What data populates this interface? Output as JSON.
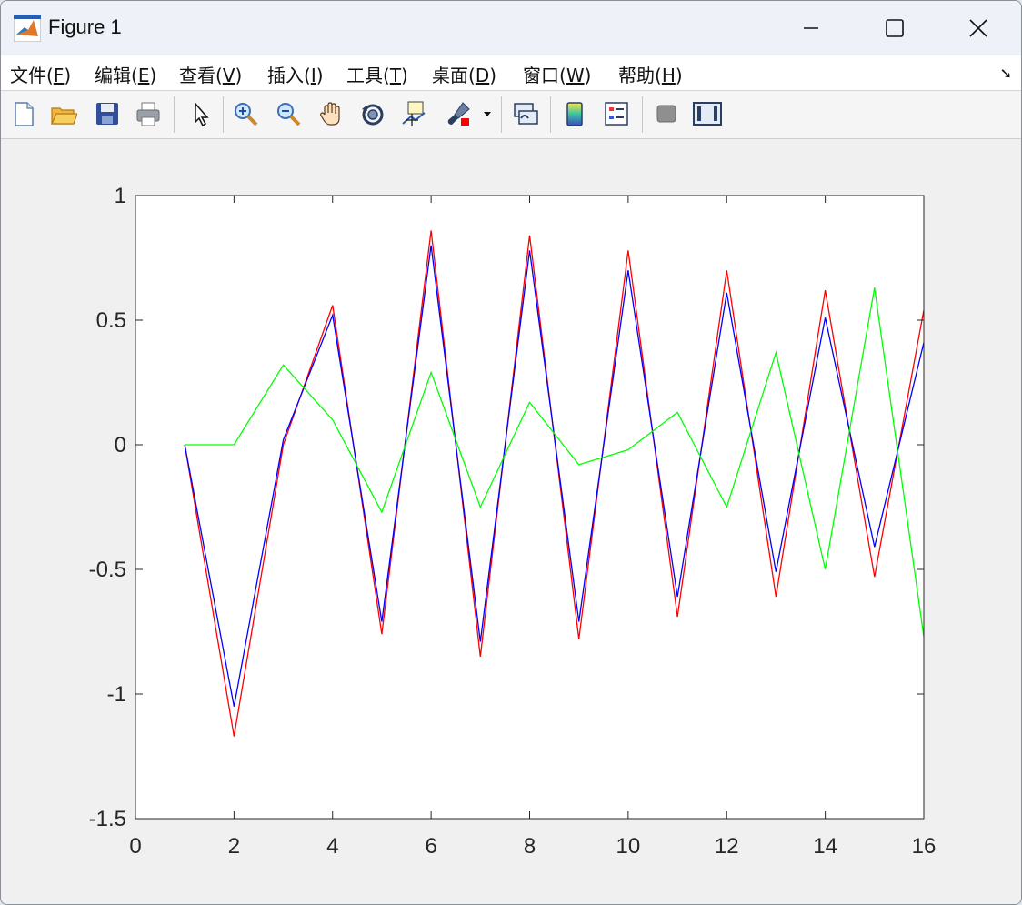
{
  "window": {
    "title": "Figure 1"
  },
  "menu": {
    "items": [
      {
        "label": "文件(",
        "mnemonic": "F",
        "tail": ")"
      },
      {
        "label": "编辑(",
        "mnemonic": "E",
        "tail": ")"
      },
      {
        "label": "查看(",
        "mnemonic": "V",
        "tail": ")"
      },
      {
        "label": "插入(",
        "mnemonic": "I",
        "tail": ")"
      },
      {
        "label": "工具(",
        "mnemonic": "T",
        "tail": ")"
      },
      {
        "label": "桌面(",
        "mnemonic": "D",
        "tail": ")"
      },
      {
        "label": "窗口(",
        "mnemonic": "W",
        "tail": ")"
      },
      {
        "label": "帮助(",
        "mnemonic": "H",
        "tail": ")"
      }
    ]
  },
  "toolbar": {
    "icons": [
      "new-figure-icon",
      "open-file-icon",
      "save-icon",
      "print-icon",
      "pointer-icon",
      "zoom-in-icon",
      "zoom-out-icon",
      "pan-hand-icon",
      "rotate-3d-icon",
      "data-cursor-icon",
      "brush-icon",
      "link-plot-icon",
      "colorbar-icon",
      "legend-icon",
      "hide-plot-tools-icon",
      "show-plot-tools-icon"
    ]
  },
  "chart_data": {
    "type": "line",
    "xlim": [
      0,
      16
    ],
    "ylim": [
      -1.5,
      1
    ],
    "xticks": [
      "0",
      "2",
      "4",
      "6",
      "8",
      "10",
      "12",
      "14",
      "16"
    ],
    "yticks": [
      "1",
      "0.5",
      "0",
      "-0.5",
      "-1",
      "-1.5"
    ],
    "grid": false,
    "x": [
      1,
      2,
      3,
      4,
      5,
      6,
      7,
      8,
      9,
      10,
      11,
      12,
      13,
      14,
      15,
      16
    ],
    "series": [
      {
        "color": "#ff0000",
        "values": [
          0,
          -1.17,
          0.0,
          0.56,
          -0.76,
          0.86,
          -0.85,
          0.84,
          -0.78,
          0.78,
          -0.69,
          0.7,
          -0.61,
          0.62,
          -0.53,
          0.54
        ]
      },
      {
        "color": "#0000ff",
        "values": [
          0,
          -1.05,
          0.02,
          0.52,
          -0.71,
          0.8,
          -0.79,
          0.78,
          -0.71,
          0.7,
          -0.61,
          0.61,
          -0.51,
          0.51,
          -0.41,
          0.41
        ]
      },
      {
        "color": "#00ff00",
        "values": [
          0,
          0,
          0.32,
          0.1,
          -0.27,
          0.29,
          -0.25,
          0.17,
          -0.08,
          -0.02,
          0.13,
          -0.25,
          0.37,
          -0.5,
          0.63,
          -0.77
        ]
      }
    ]
  }
}
